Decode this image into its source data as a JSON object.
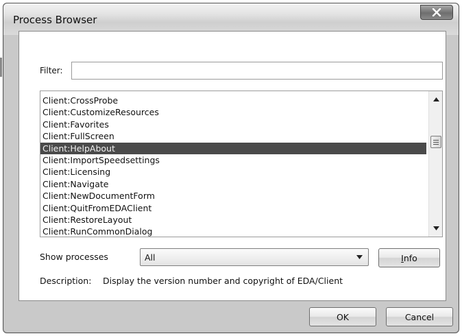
{
  "window": {
    "title": "Process Browser",
    "close_icon": "close-x-icon"
  },
  "filter": {
    "label": "Filter:",
    "value": "",
    "placeholder": ""
  },
  "process_list": {
    "items": [
      "Client:CrossProbe",
      "Client:CustomizeResources",
      "Client:Favorites",
      "Client:FullScreen",
      "Client:HelpAbout",
      "Client:ImportSpeedsettings",
      "Client:Licensing",
      "Client:Navigate",
      "Client:NewDocumentForm",
      "Client:QuitFromEDAClient",
      "Client:RestoreLayout",
      "Client:RunCommonDialog"
    ],
    "selected_index": 4,
    "selection_color": "#4a4a4a"
  },
  "show_processes": {
    "label": "Show processes",
    "selected": "All"
  },
  "info_button": {
    "underlined": "I",
    "rest": "nfo"
  },
  "description": {
    "label": "Description:",
    "value": "Display the version number and copyright of EDA/Client"
  },
  "footer": {
    "ok_label": "OK",
    "cancel_label": "Cancel"
  }
}
